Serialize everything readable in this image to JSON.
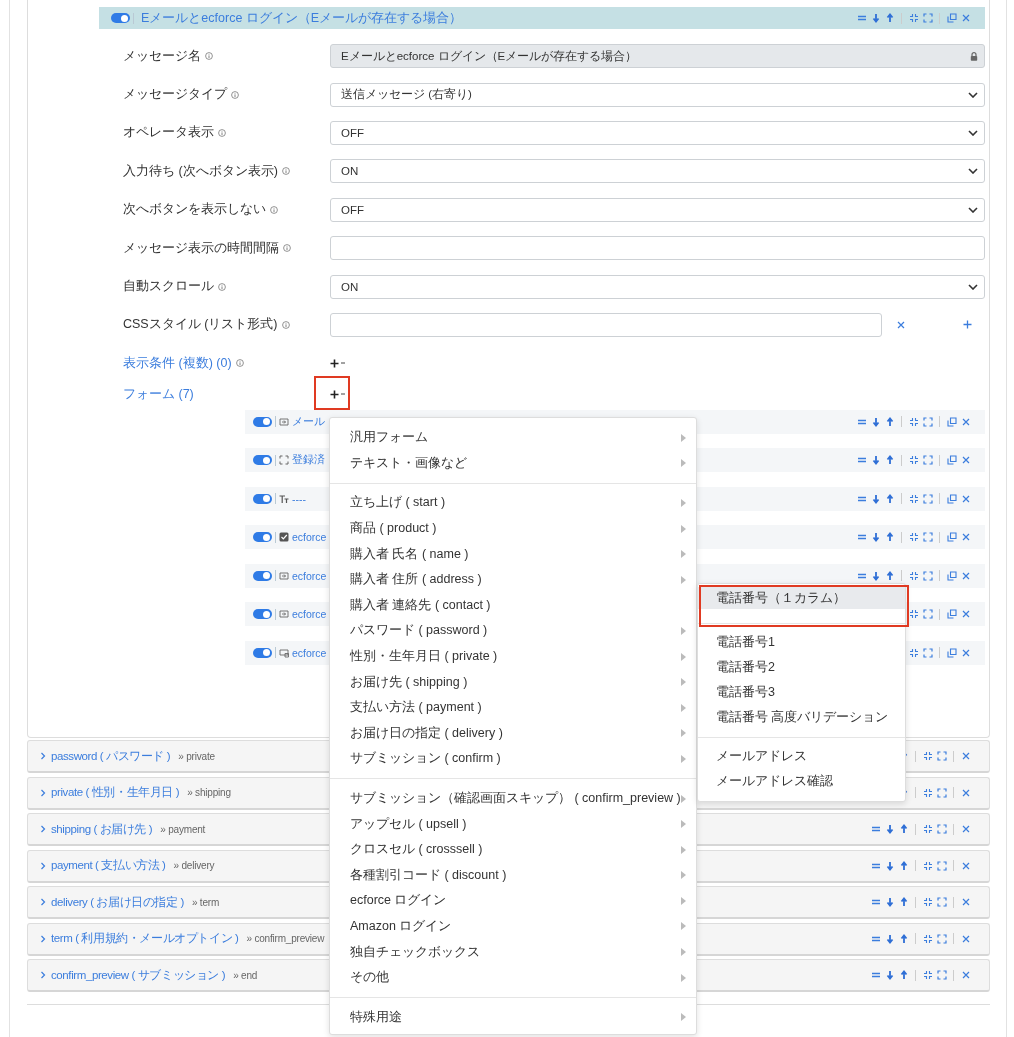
{
  "header": {
    "enabled": true,
    "title": "Eメールとecforce ログイン（Eメールが存在する場合）"
  },
  "settings": [
    {
      "kind": "locked",
      "label": "メッセージ名",
      "value": "Eメールとecforce ログイン（Eメールが存在する場合）"
    },
    {
      "kind": "select",
      "label": "メッセージタイプ",
      "value": "送信メッセージ (右寄り)"
    },
    {
      "kind": "select",
      "label": "オペレータ表示",
      "value": "OFF"
    },
    {
      "kind": "select",
      "label": "入力待ち (次へボタン表示)",
      "value": "ON"
    },
    {
      "kind": "select",
      "label": "次へボタンを表示しない",
      "value": "OFF"
    },
    {
      "kind": "text",
      "label": "メッセージ表示の時間間隔"
    },
    {
      "kind": "select",
      "label": "自動スクロール",
      "value": "ON"
    },
    {
      "kind": "list",
      "label": "CSSスタイル (リスト形式)"
    }
  ],
  "conditions": {
    "label": "表示条件 (複数) (0)"
  },
  "forms": {
    "label": "フォーム (7)",
    "highlighted": true,
    "items": [
      {
        "enabled": true,
        "label": "メール"
      },
      {
        "enabled": true,
        "label": "登録済"
      },
      {
        "enabled": true,
        "label": "----"
      },
      {
        "enabled": true,
        "label": "ecforce"
      },
      {
        "enabled": true,
        "label": "ecforce"
      },
      {
        "enabled": true,
        "label": "ecforce"
      },
      {
        "enabled": true,
        "label": "ecforce"
      }
    ]
  },
  "menu": {
    "groups": [
      [
        {
          "label": "汎用フォーム",
          "expanded": false
        },
        {
          "label": "テキスト・画像など",
          "expanded": false
        }
      ],
      [
        {
          "label": "立ち上げ ( start )",
          "expanded": false
        },
        {
          "label": "商品 ( product )",
          "expanded": false
        },
        {
          "label": "購入者 氏名 ( name )",
          "expanded": false
        },
        {
          "label": "購入者 住所 ( address )",
          "expanded": false
        },
        {
          "label": "購入者 連絡先 ( contact )",
          "expanded": true
        },
        {
          "label": "パスワード ( password )",
          "expanded": false
        },
        {
          "label": "性別・生年月日 ( private )",
          "expanded": false
        },
        {
          "label": "お届け先 ( shipping )",
          "expanded": false
        },
        {
          "label": "支払い方法 ( payment )",
          "expanded": false
        },
        {
          "label": "お届け日の指定 ( delivery )",
          "expanded": false
        },
        {
          "label": "サブミッション ( confirm )",
          "expanded": false
        }
      ],
      [
        {
          "label": "サブミッション（確認画面スキップ） ( confirm_preview )",
          "expanded": false
        },
        {
          "label": "アップセル ( upsell )",
          "expanded": false
        },
        {
          "label": "クロスセル ( crosssell )",
          "expanded": false
        },
        {
          "label": "各種割引コード ( discount )",
          "expanded": false
        },
        {
          "label": "ecforce ログイン",
          "expanded": false
        },
        {
          "label": "Amazon ログイン",
          "expanded": false
        },
        {
          "label": "独自チェックボックス",
          "expanded": false
        },
        {
          "label": "その他",
          "expanded": false
        }
      ],
      [
        {
          "label": "特殊用途",
          "expanded": false
        }
      ]
    ]
  },
  "submenu": {
    "groups": [
      [
        {
          "label": "電話番号（１カラム）",
          "selected": true,
          "highlighted": true
        }
      ],
      [
        {
          "label": "電話番号1",
          "selected": false,
          "highlighted": false
        },
        {
          "label": "電話番号2",
          "selected": false,
          "highlighted": false
        },
        {
          "label": "電話番号3",
          "selected": false,
          "highlighted": false
        },
        {
          "label": "電話番号 高度バリデーション",
          "selected": false,
          "highlighted": false
        }
      ],
      [
        {
          "label": "メールアドレス",
          "selected": false,
          "highlighted": false
        },
        {
          "label": "メールアドレス確認",
          "selected": false,
          "highlighted": false
        }
      ]
    ]
  },
  "sections": [
    {
      "name": "password ( パスワード )",
      "next": "» private",
      "expanded": false
    },
    {
      "name": "private ( 性別・生年月日 )",
      "next": "» shipping",
      "expanded": false
    },
    {
      "name": "shipping ( お届け先 )",
      "next": "» payment",
      "expanded": false
    },
    {
      "name": "payment ( 支払い方法 )",
      "next": "» delivery",
      "expanded": false
    },
    {
      "name": "delivery ( お届け日の指定 )",
      "next": "» term",
      "expanded": false
    },
    {
      "name": "term ( 利用規約・メールオプトイン )",
      "next": "» confirm_preview",
      "expanded": false
    },
    {
      "name": "confirm_preview ( サブミッション )",
      "next": "» end",
      "expanded": false
    }
  ]
}
